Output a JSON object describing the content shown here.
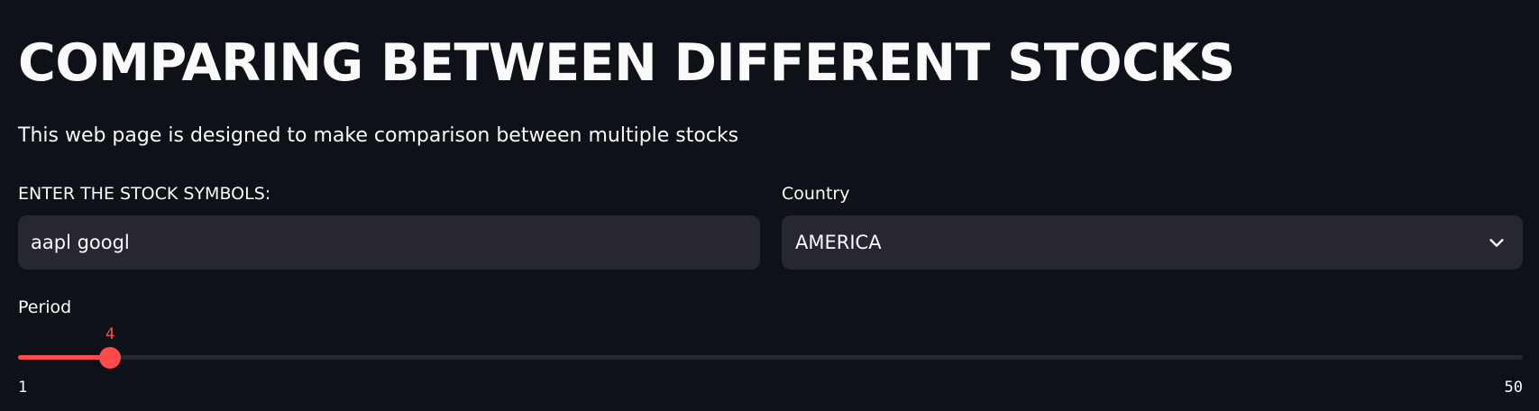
{
  "header": {
    "title": "COMPARING BETWEEN DIFFERENT STOCKS",
    "subtitle": "This web page is designed to make comparison between multiple stocks"
  },
  "symbols_input": {
    "label": "ENTER THE STOCK SYMBOLS:",
    "value": "aapl googl"
  },
  "country_select": {
    "label": "Country",
    "selected": "AMERICA",
    "icon": "chevron-down-icon"
  },
  "period_slider": {
    "label": "Period",
    "value": 4,
    "value_label": "4",
    "min": 1,
    "max": 50,
    "min_label": "1",
    "max_label": "50"
  },
  "colors": {
    "background": "#0e1118",
    "surface": "#262730",
    "text": "#fafafa",
    "accent": "#ff4b4b"
  }
}
